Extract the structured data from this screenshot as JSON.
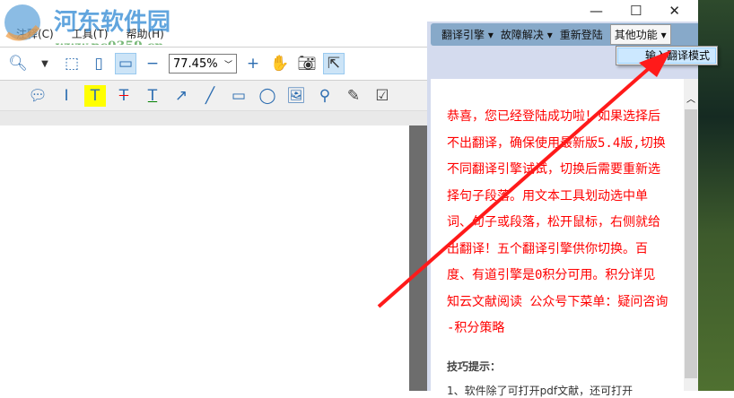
{
  "watermark": {
    "name": "河东软件园",
    "url": "www.pc0359.cn"
  },
  "menubar": [
    "注释(C)",
    "工具(T)",
    "帮助(H)"
  ],
  "toolbar": {
    "zoom_value": "77.45%"
  },
  "window_controls": {
    "minimize": "—",
    "maximize": "☐",
    "close": "✕"
  },
  "translate_toolbar": {
    "items": [
      "翻译引擎",
      "故障解决",
      "重新登陆",
      "其他功能"
    ]
  },
  "dropdown": {
    "item": "输入翻译模式"
  },
  "message": [
    "恭喜，您已经登陆成功啦！如果选择后",
    "不出翻译，确保使用最新版5.4版,切换",
    "不同翻译引擎试试，切换后需要重新选",
    "择句子段落。用文本工具划动选中单",
    "词、句子或段落，松开鼠标，右侧就给",
    "出翻译！五个翻译引擎供你切换。百",
    "度、有道引擎是0积分可用。积分详见",
    "知云文献阅读 公众号下菜单：疑问咨询",
    "-积分策略"
  ],
  "tips": {
    "heading": "技巧提示：",
    "line1": "1、软件除了可打开pdf文献，还可打开"
  },
  "colors": {
    "accent": "#87a9c9",
    "message": "#ff0000",
    "arrow": "#ff1a1a"
  }
}
